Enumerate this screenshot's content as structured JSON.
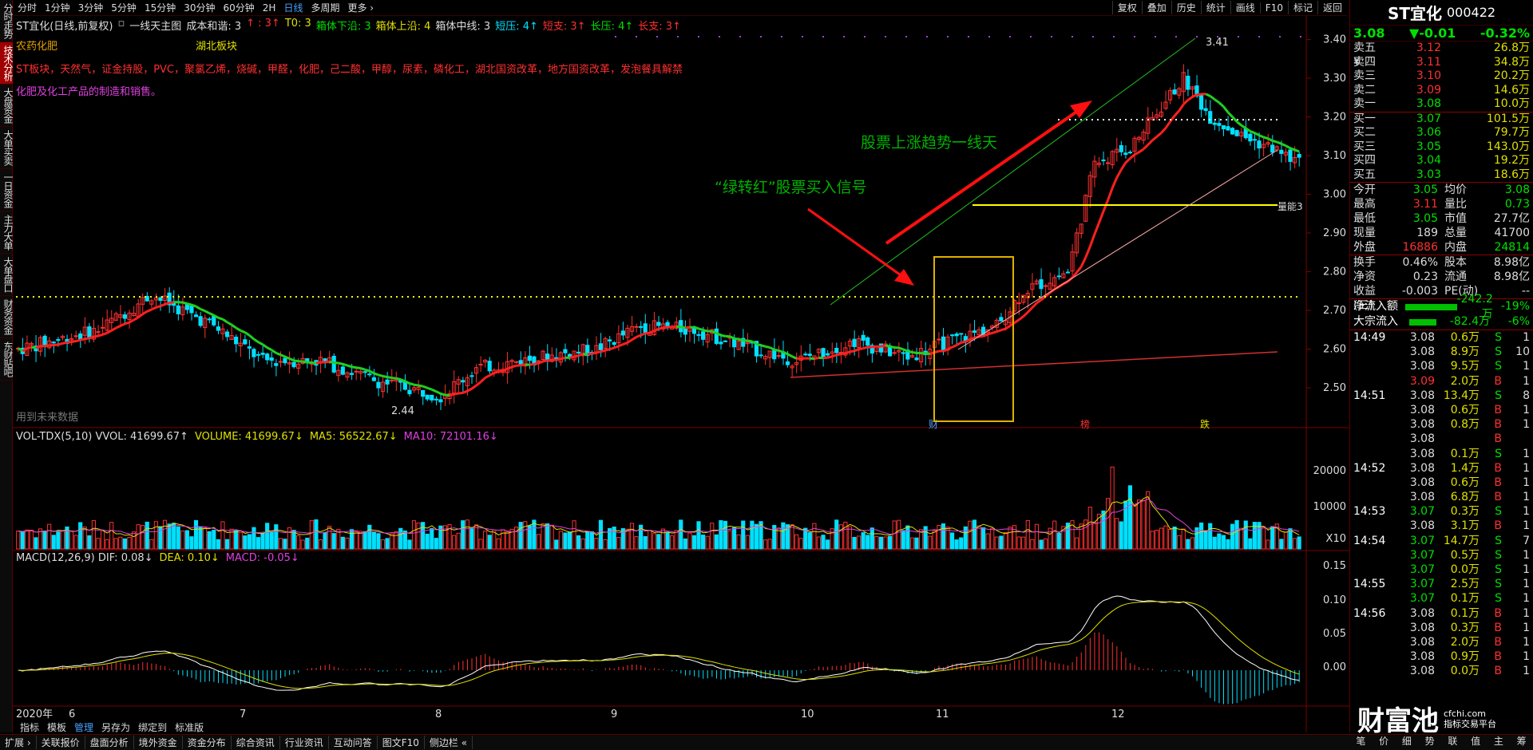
{
  "left_tabs": [
    "分时走势",
    "技术分析",
    "大盘资金",
    "大单买卖",
    "一日资金",
    "主力大单",
    "大单盘口",
    "财务资金",
    "东财贴吧"
  ],
  "left_active": 1,
  "periods": [
    "分时",
    "1分钟",
    "3分钟",
    "5分钟",
    "15分钟",
    "30分钟",
    "60分钟",
    "2H",
    "日线",
    "多周期",
    "更多 ›"
  ],
  "period_active": 8,
  "toolbar": [
    "复权",
    "叠加",
    "历史",
    "统计",
    "画线",
    "F10",
    "标记",
    "返回"
  ],
  "legend": [
    {
      "t": "ST宜化(日线,前复权)",
      "c": "#ddd"
    },
    {
      "t": "▫",
      "c": "#aaa"
    },
    {
      "t": "一线天主图",
      "c": "#ddd"
    },
    {
      "t": "成本和谐: 3",
      "c": "#ddd"
    },
    {
      "t": "↑ : 3↑",
      "c": "#ff3030"
    },
    {
      "t": "T0: 3",
      "c": "#e0e000"
    },
    {
      "t": "箱体下沿: 3",
      "c": "#00e000"
    },
    {
      "t": "箱体上沿: 4",
      "c": "#e0e000"
    },
    {
      "t": "箱体中线: 3",
      "c": "#ddd"
    },
    {
      "t": "短压: 4↑",
      "c": "#00e0ff"
    },
    {
      "t": "短支: 3↑",
      "c": "#ff3030"
    },
    {
      "t": "长压: 4↑",
      "c": "#00e000"
    },
    {
      "t": "长支: 3↑",
      "c": "#ff3030"
    }
  ],
  "info": {
    "sector1": "农药化肥",
    "sector2": "湖北板块",
    "concepts": "ST板块，天然气，证金持股，PVC，聚氯乙烯，烧碱，甲醛，化肥，己二酸，甲醇，尿素，磷化工，湖北国资改革，地方国资改革，发泡餐具解禁",
    "business": "化肥及化工产品的制造和销售。",
    "future": "用到未来数据"
  },
  "annot": {
    "trend": "股票上涨趋势一线天",
    "signal": "“绿转红”股票买入信号",
    "hi": "3.41",
    "lo": "2.44",
    "ext": "量能3"
  },
  "axis_main": [
    "3.40",
    "3.30",
    "3.20",
    "3.10",
    "3.00",
    "2.90",
    "2.80",
    "2.70",
    "2.60",
    "2.50"
  ],
  "axis_vol": [
    "20000",
    "10000",
    "X10"
  ],
  "axis_macd": [
    "0.15",
    "0.10",
    "0.05",
    "0.00"
  ],
  "months": [
    "2020年",
    "6",
    "7",
    "8",
    "9",
    "10",
    "11",
    "12"
  ],
  "events": [
    "财",
    "榜",
    "跌"
  ],
  "vol_legend": [
    {
      "t": "VOL-TDX(5,10) VVOL: 41699.67↑",
      "c": "#ddd"
    },
    {
      "t": "VOLUME: 41699.67↓",
      "c": "#e0e000"
    },
    {
      "t": "MA5: 56522.67↓",
      "c": "#e0e000"
    },
    {
      "t": "MA10: 72101.16↓",
      "c": "#e040e0"
    }
  ],
  "macd_legend": [
    {
      "t": "MACD(12,26,9) DIF: 0.08↓",
      "c": "#ddd"
    },
    {
      "t": "DEA: 0.10↓",
      "c": "#e0e000"
    },
    {
      "t": "MACD: -0.05↓",
      "c": "#e040e0"
    }
  ],
  "ind_bar": [
    "指标",
    "模板",
    "管理",
    "另存为",
    "绑定到",
    "标准版"
  ],
  "ind_active": 2,
  "bottom": [
    "扩展 ›",
    "关联报价",
    "盘面分析",
    "境外资金",
    "资金分布",
    "综合资讯",
    "行业资讯",
    "互动问答",
    "图文F10",
    "侧边栏 «"
  ],
  "quote": {
    "name": "ST宜化",
    "code": "000422",
    "price": "3.08",
    "chg": "▼-0.01",
    "pct": "-0.32%",
    "asks": [
      [
        "卖五 ¥",
        "3.12",
        "26.8万",
        "#ff3030"
      ],
      [
        "卖四",
        "3.11",
        "34.8万",
        "#ff3030"
      ],
      [
        "卖三",
        "3.10",
        "20.2万",
        "#ff3030"
      ],
      [
        "卖二",
        "3.09",
        "14.6万",
        "#ff3030"
      ],
      [
        "卖一",
        "3.08",
        "10.0万",
        "#00e000"
      ]
    ],
    "bids": [
      [
        "买一",
        "3.07",
        "101.5万",
        "#00e000"
      ],
      [
        "买二",
        "3.06",
        "79.7万",
        "#00e000"
      ],
      [
        "买三",
        "3.05",
        "143.0万",
        "#00e000"
      ],
      [
        "买四",
        "3.04",
        "19.2万",
        "#00e000"
      ],
      [
        "买五",
        "3.03",
        "18.6万",
        "#00e000"
      ]
    ],
    "stats": [
      [
        "今开",
        "3.05",
        "#00e000",
        "均价",
        "3.08",
        "#00e000"
      ],
      [
        "最高",
        "3.11",
        "#ff3030",
        "量比",
        "0.73",
        "#00e000"
      ],
      [
        "最低",
        "3.05",
        "#00e000",
        "市值",
        "27.7亿",
        "#ddd"
      ],
      [
        "现量",
        "189",
        "#ddd",
        "总量",
        "41700",
        "#ddd"
      ],
      [
        "外盘",
        "16886",
        "#ff3030",
        "内盘",
        "24814",
        "#00e000"
      ]
    ],
    "stats2": [
      [
        "换手",
        "0.46%",
        "#ddd",
        "股本",
        "8.98亿",
        "#ddd"
      ],
      [
        "净资",
        "0.23",
        "#ddd",
        "流通",
        "8.98亿",
        "#ddd"
      ],
      [
        "收益(三)",
        "-0.003",
        "#ddd",
        "PE(动)",
        "--",
        "#ddd"
      ]
    ],
    "flows": [
      [
        "净流入额",
        "-242.2万",
        "-19%"
      ],
      [
        "大宗流入",
        "-82.4万",
        "-6%"
      ]
    ],
    "ticks": [
      [
        "14:49",
        "3.08",
        "0.6万",
        "S",
        "1"
      ],
      [
        "",
        "3.08",
        "8.9万",
        "S",
        "10"
      ],
      [
        "",
        "3.08",
        "9.5万",
        "S",
        "1"
      ],
      [
        "",
        "3.09",
        "2.0万",
        "B",
        "1"
      ],
      [
        "14:51",
        "3.08",
        "13.4万",
        "S",
        "8"
      ],
      [
        "",
        "3.08",
        "0.6万",
        "B",
        "1"
      ],
      [
        "",
        "3.08",
        "0.8万",
        "B",
        "1"
      ],
      [
        "",
        "3.08",
        "",
        "B",
        ""
      ],
      [
        "",
        "3.08",
        "0.1万",
        "S",
        "1"
      ],
      [
        "14:52",
        "3.08",
        "1.4万",
        "B",
        "1"
      ],
      [
        "",
        "3.08",
        "0.6万",
        "B",
        "1"
      ],
      [
        "",
        "3.08",
        "6.8万",
        "B",
        "1"
      ],
      [
        "14:53",
        "3.07",
        "0.3万",
        "S",
        "1"
      ],
      [
        "",
        "3.08",
        "3.1万",
        "B",
        "1"
      ],
      [
        "14:54",
        "3.07",
        "14.7万",
        "S",
        "7"
      ],
      [
        "",
        "3.07",
        "0.5万",
        "S",
        "1"
      ],
      [
        "",
        "3.07",
        "0.0万",
        "S",
        "1"
      ],
      [
        "14:55",
        "3.07",
        "2.5万",
        "S",
        "1"
      ],
      [
        "",
        "3.07",
        "0.1万",
        "S",
        "1"
      ],
      [
        "14:56",
        "3.08",
        "0.1万",
        "B",
        "1"
      ],
      [
        "",
        "3.08",
        "0.3万",
        "B",
        "1"
      ],
      [
        "",
        "3.08",
        "2.0万",
        "B",
        "1"
      ],
      [
        "",
        "3.08",
        "0.9万",
        "B",
        "1"
      ],
      [
        "",
        "3.08",
        "0.0万",
        "B",
        "1"
      ]
    ]
  },
  "watermark": {
    "big": "财富池",
    "site": "cfchi.com",
    "tag": "指标交易平台"
  },
  "qtabs": [
    "笔",
    "价",
    "细",
    "势",
    "联",
    "值",
    "主",
    "筹"
  ],
  "chart_data": {
    "type": "candlestick",
    "ylim": [
      2.44,
      3.41
    ],
    "high": 3.41,
    "low": 2.44
  }
}
